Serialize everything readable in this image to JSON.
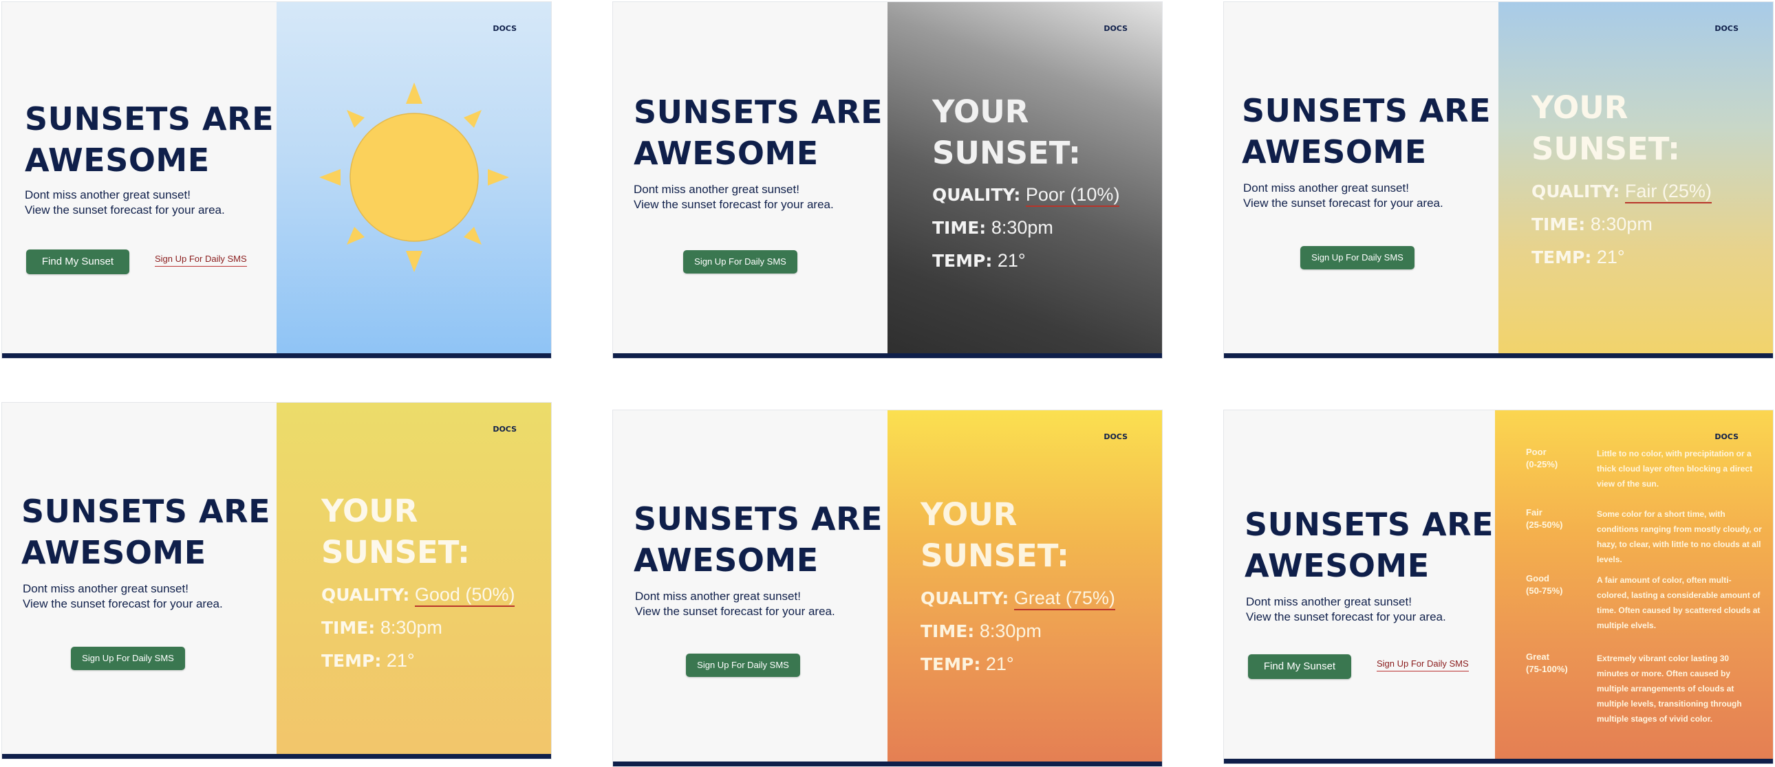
{
  "common": {
    "headline_line1": "SUNSETS ARE",
    "headline_line2": "AWESOME",
    "subtitle_line1": "Dont miss another great sunset!",
    "subtitle_line2": "View the sunset forecast for your area.",
    "find_button": "Find My Sunset",
    "sms_button": "Sign Up For Daily SMS",
    "sms_link": "Sign Up For Daily SMS",
    "docs_link": "DOCS",
    "your_sunset_line1": "YOUR",
    "your_sunset_line2": "SUNSET:",
    "quality_label": "QUALITY:",
    "time_label": "TIME:",
    "time_value": "8:30pm",
    "temp_label": "TEMP:",
    "temp_value": "21°"
  },
  "screens": [
    {
      "id": "sunny",
      "icon": "sun-icon"
    },
    {
      "id": "poor",
      "quality_value": "Poor (10%)"
    },
    {
      "id": "fair",
      "quality_value": "Fair (25%)"
    },
    {
      "id": "good",
      "quality_value": "Good (50%)"
    },
    {
      "id": "great",
      "quality_value": "Great (75%)"
    },
    {
      "id": "legend",
      "legend": [
        {
          "category_line1": "Poor",
          "category_line2": "(0-25%)",
          "description": "Little to no color, with precipitation or a thick cloud layer often blocking a direct view of the sun."
        },
        {
          "category_line1": "Fair",
          "category_line2": "(25-50%)",
          "description": "Some color for a short time, with conditions ranging from mostly cloudy, or hazy, to clear, with little to no clouds at all levels."
        },
        {
          "category_line1": "Good",
          "category_line2": "(50-75%)",
          "description": "A fair amount of color, often multi-colored, lasting a considerable amount of time. Often caused by scattered clouds at multiple elvels."
        },
        {
          "category_line1": "Great",
          "category_line2": "(75-100%)",
          "description": "Extremely vibrant color lasting 30 minutes or more. Often caused by multiple arrangements of clouds at multiple levels, transitioning through multiple stages of vivid color."
        }
      ]
    }
  ],
  "colors": {
    "navy": "#0f1f4a",
    "green_button": "#3a7750",
    "link_red": "#8a1c1c",
    "sky_blue": "#94c6f5",
    "sun_yellow": "#fbd15b"
  }
}
